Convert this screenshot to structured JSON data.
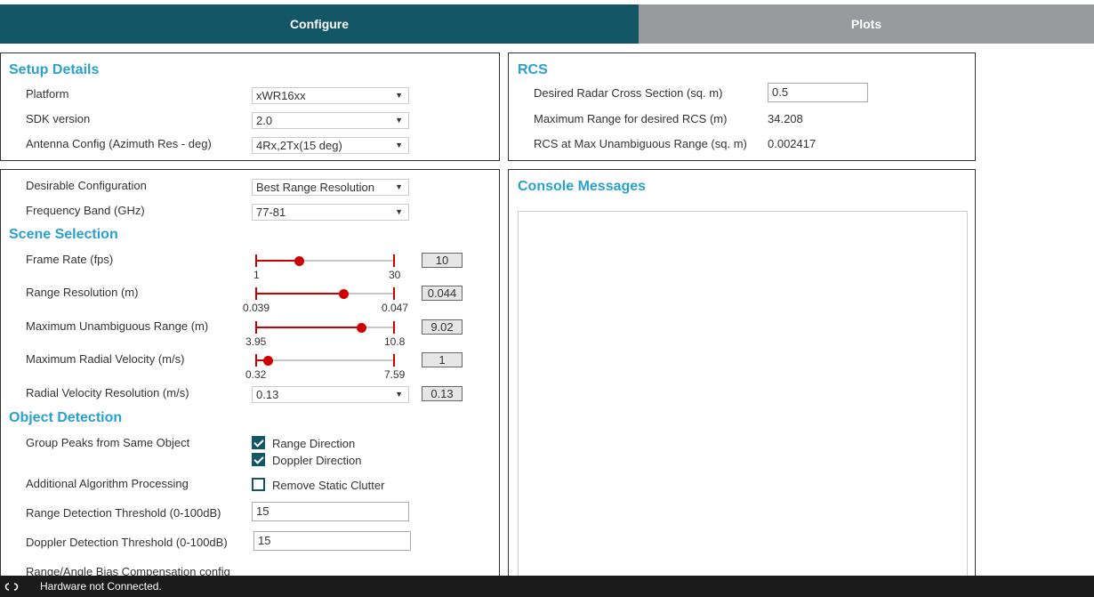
{
  "tabs": {
    "configure": "Configure",
    "plots": "Plots"
  },
  "setup": {
    "title": "Setup Details",
    "platform_label": "Platform",
    "platform_value": "xWR16xx",
    "sdk_label": "SDK version",
    "sdk_value": "2.0",
    "antenna_label": "Antenna Config (Azimuth Res - deg)",
    "antenna_value": "4Rx,2Tx(15 deg)"
  },
  "rcs": {
    "title": "RCS",
    "desired_label": "Desired Radar Cross Section (sq. m)",
    "desired_value": "0.5",
    "max_range_label": "Maximum Range for desired RCS (m)",
    "max_range_value": "34.208",
    "rcs_max_label": "RCS at Max Unambiguous Range (sq. m)",
    "rcs_max_value": "0.002417"
  },
  "config": {
    "desirable_label": "Desirable Configuration",
    "desirable_value": "Best Range Resolution",
    "freq_label": "Frequency Band (GHz)",
    "freq_value": "77-81"
  },
  "scene": {
    "title": "Scene Selection",
    "frame_rate": {
      "label": "Frame Rate (fps)",
      "min": "1",
      "max": "30",
      "value": "10",
      "fraction": 0.31
    },
    "range_res": {
      "label": "Range Resolution (m)",
      "min": "0.039",
      "max": "0.047",
      "value": "0.044",
      "fraction": 0.63
    },
    "max_range": {
      "label": "Maximum Unambiguous Range (m)",
      "min": "3.95",
      "max": "10.8",
      "value": "9.02",
      "fraction": 0.76
    },
    "max_vel": {
      "label": "Maximum Radial Velocity (m/s)",
      "min": "0.32",
      "max": "7.59",
      "value": "1",
      "fraction": 0.09
    },
    "vel_res_label": "Radial Velocity Resolution (m/s)",
    "vel_res_value": "0.13",
    "vel_res_box": "0.13"
  },
  "detection": {
    "title": "Object Detection",
    "group_label": "Group Peaks from Same Object",
    "range_dir": "Range Direction",
    "doppler_dir": "Doppler Direction",
    "algo_label": "Additional Algorithm Processing",
    "static_clutter": "Remove Static Clutter",
    "range_thresh_label": "Range Detection Threshold (0-100dB)",
    "range_thresh_value": "15",
    "doppler_thresh_label": "Doppler Detection Threshold (0-100dB)",
    "doppler_thresh_value": "15",
    "bias_label": "Range/Angle Bias Compensation config"
  },
  "console": {
    "title": "Console Messages"
  },
  "status": {
    "icon": "link-icon",
    "text": "Hardware not Connected."
  },
  "colors": {
    "accent": "#135767",
    "heading": "#2aa0cf",
    "slider": "#cc0000",
    "tab_inactive": "#999a9b"
  }
}
